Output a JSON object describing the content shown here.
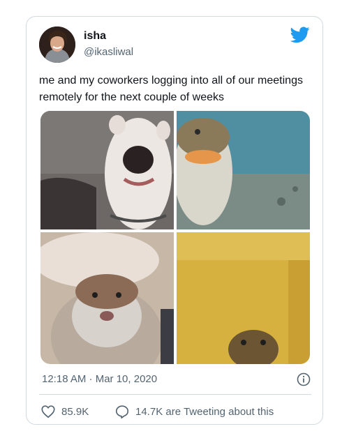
{
  "tweet": {
    "author": {
      "display_name": "isha",
      "handle": "@ikasliwal",
      "avatar_icon": "profile-photo"
    },
    "platform_icon": "twitter-bird-icon",
    "brand_color": "#1d9bf0",
    "text": "me and my coworkers logging into all of our meetings remotely for the next couple of weeks",
    "media": [
      {
        "subject": "dog-close-up-photo"
      },
      {
        "subject": "fish-close-up-photo"
      },
      {
        "subject": "hamster-close-up-photo"
      },
      {
        "subject": "lizard-peeking-photo"
      }
    ],
    "timestamp": "12:18 AM · Mar 10, 2020",
    "info_icon": "info-icon",
    "actions": {
      "likes": {
        "icon": "heart-icon",
        "count": "85.9K"
      },
      "tweeting": {
        "icon": "reply-bubble-icon",
        "label": "14.7K are Tweeting about this"
      }
    }
  }
}
